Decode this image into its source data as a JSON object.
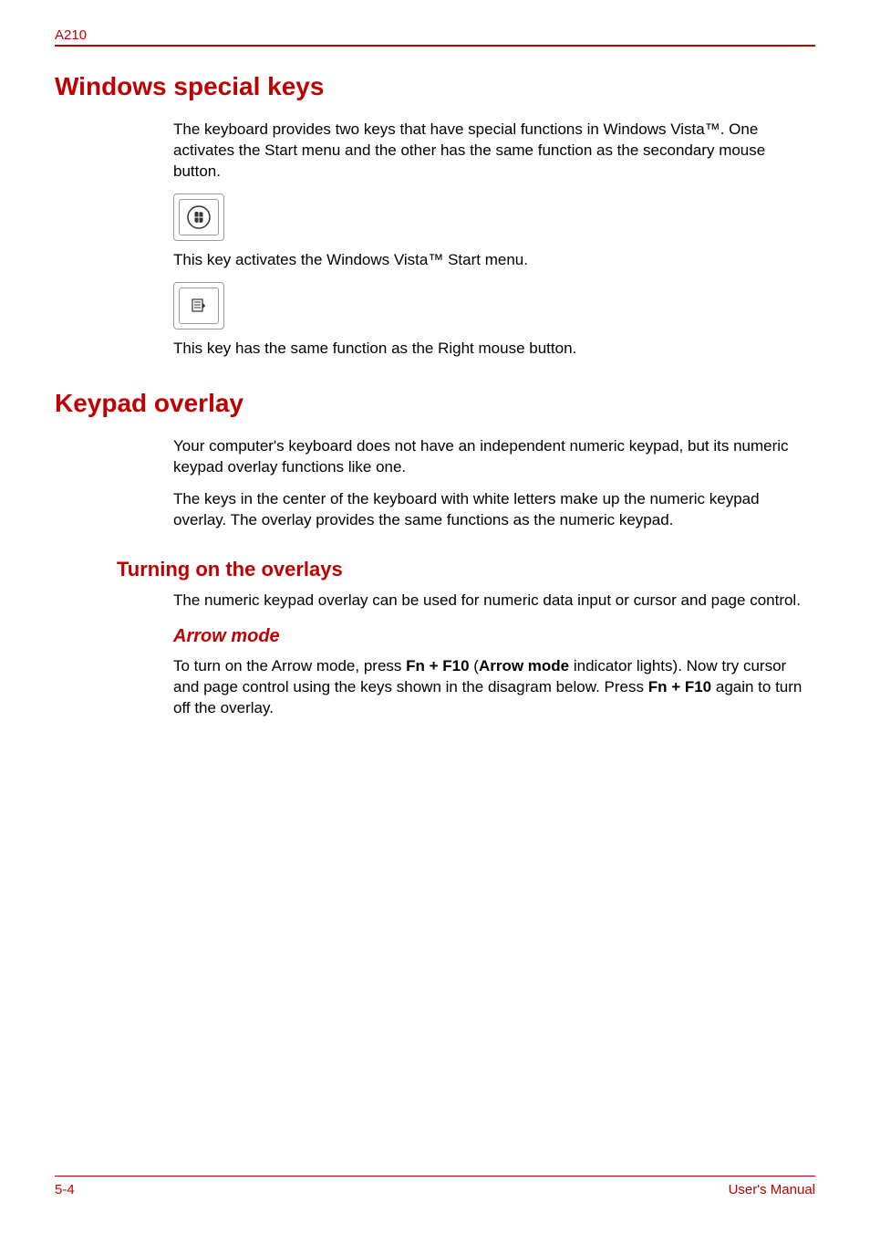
{
  "header": {
    "label": "A210"
  },
  "section1": {
    "title": "Windows special keys",
    "p1": "The keyboard provides two keys that have special functions in Windows Vista™. One activates the Start menu and the other has the same function as the secondary mouse button.",
    "p2": "This key activates the Windows Vista™ Start menu.",
    "p3": "This key has the same function as the Right mouse button."
  },
  "section2": {
    "title": "Keypad overlay",
    "p1": "Your computer's keyboard does not have an independent numeric keypad, but its numeric keypad overlay functions like one.",
    "p2": "The keys in the center of the keyboard with white letters make up the numeric keypad overlay. The overlay provides the same functions as the numeric keypad.",
    "sub1": {
      "title": "Turning on the overlays",
      "p1": "The numeric keypad overlay can be used for numeric data input or cursor and page control."
    },
    "sub2": {
      "title": "Arrow mode",
      "p_prefix": "To turn on the Arrow mode, press ",
      "p_bold1": "Fn + F10",
      "p_mid1": " (",
      "p_bold2": "Arrow mode",
      "p_mid2": " indicator lights). Now try cursor and page control using the keys shown in the disagram below. Press ",
      "p_bold3": "Fn + F10",
      "p_suffix": " again to turn off the overlay."
    }
  },
  "footer": {
    "page": "5-4",
    "label": "User's Manual"
  }
}
